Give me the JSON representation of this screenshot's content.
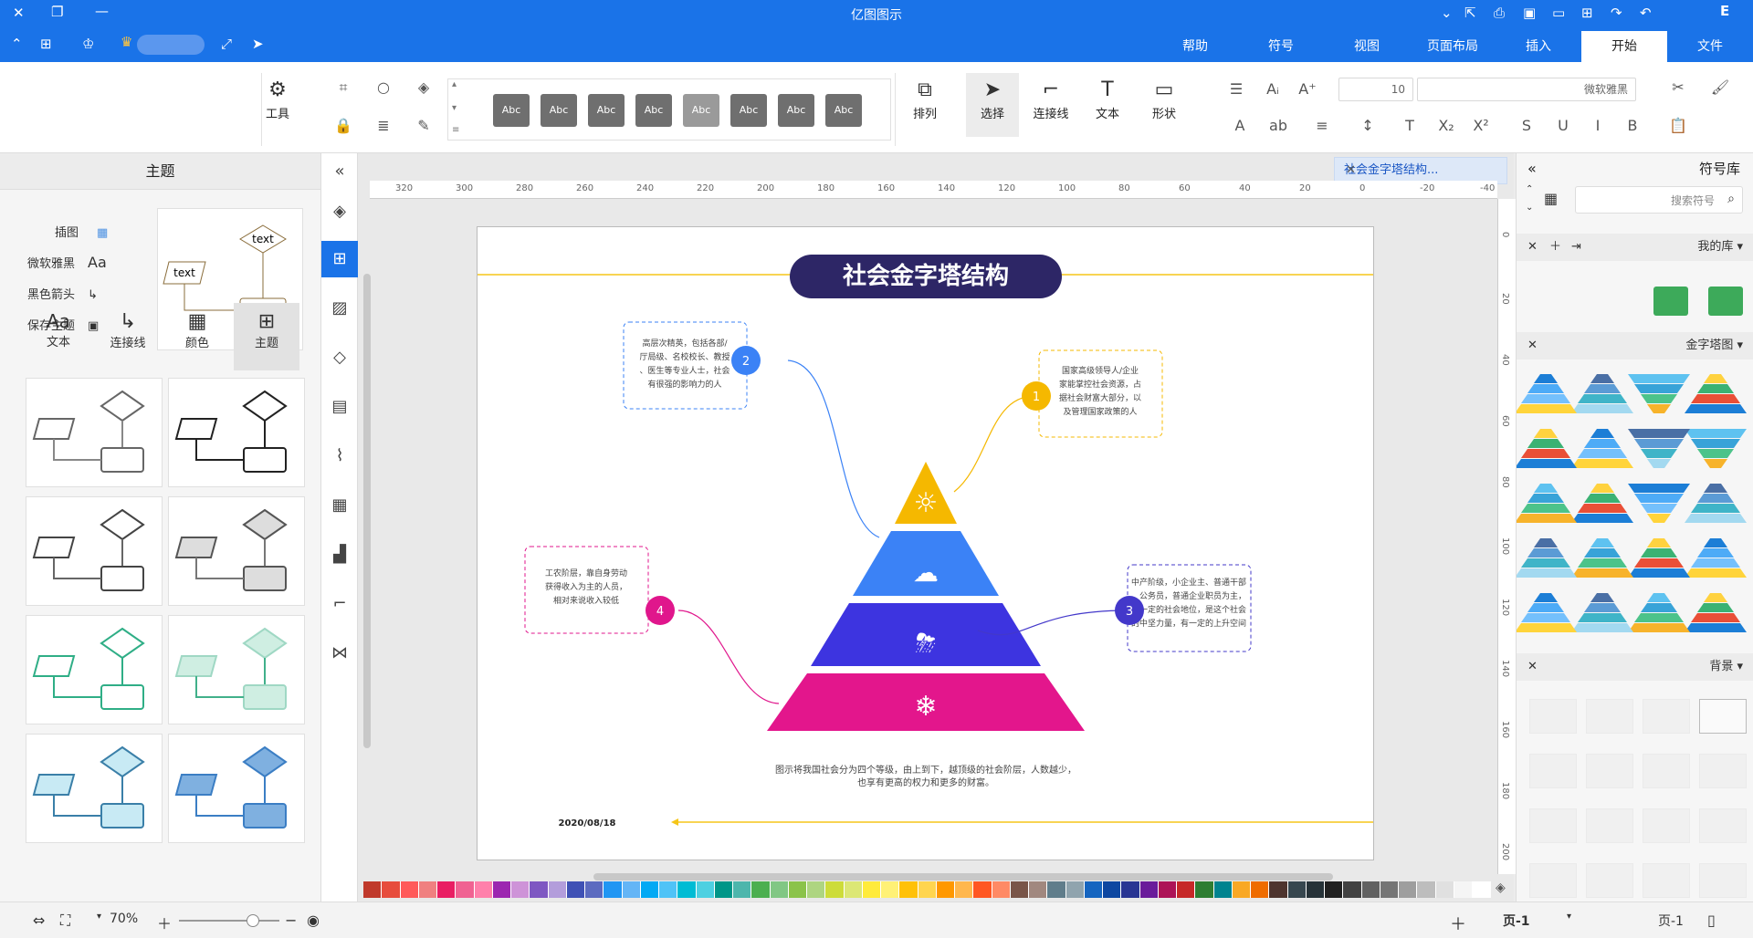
{
  "app": {
    "window_title": "亿图图示",
    "menu_tabs": [
      "文件",
      "开始",
      "插入",
      "页面布局",
      "视图",
      "符号",
      "帮助"
    ],
    "active_tab": "开始"
  },
  "ribbon": {
    "cut_icon": "scissors-icon",
    "paste_icon": "clipboard-icon",
    "format_painter_icon": "brush-icon",
    "font_name": "微软雅黑",
    "font_size": "10",
    "btn_shape": "形状",
    "btn_text": "文本",
    "btn_connector": "连接线",
    "btn_select": "选择",
    "btn_arrange": "排列",
    "btn_tools": "工具",
    "style_chip_label": "Abc"
  },
  "symbols_panel": {
    "title": "符号库",
    "search_placeholder": "搜索符号",
    "my_library": "我的库",
    "pyramid_category": "金字塔图",
    "background_category": "背景"
  },
  "doc_tab": {
    "label": "社会金字塔结构..."
  },
  "ruler": {
    "top_ticks": [
      "-40",
      "-20",
      "0",
      "20",
      "40",
      "60",
      "80",
      "100",
      "120",
      "140",
      "160",
      "180",
      "200",
      "220",
      "240",
      "260",
      "280",
      "300",
      "320"
    ],
    "left_ticks": [
      "0",
      "20",
      "40",
      "60",
      "80",
      "100",
      "120",
      "140",
      "160",
      "180",
      "200"
    ]
  },
  "diagram": {
    "title": "社会金字塔结构",
    "date": "2020/08/18",
    "caption_line1": "图示将我国社会分为四个等级，由上到下，越顶级的社会阶层，人数越少，",
    "caption_line2": "也享有更高的权力和更多的财富。",
    "levels": [
      {
        "num": "1",
        "color": "#f5b800",
        "text": "国家高级领导人/企业家能掌控社会资源，占据社会财富大部分，以及管理国家政策的人"
      },
      {
        "num": "2",
        "color": "#3b82f6",
        "text": "高层次精英，包括各部/厅局级、名校校长、教授、医生等专业人士，社会有很强的影响力的人"
      },
      {
        "num": "3",
        "color": "#4338ca",
        "text": "中产阶级，小企业主、普通干部、公务员，普通企业职员为主，有一定的社会地位，是这个社会的中坚力量，有一定的上升空间"
      },
      {
        "num": "4",
        "color": "#e0168c",
        "text": "工农阶层，靠自身劳动获得收入为主的人员，相对来说收入较低"
      }
    ],
    "pyramid_colors": [
      "#f5b800",
      "#3b82f6",
      "#3d34e0",
      "#e3168c"
    ]
  },
  "theme_panel": {
    "title": "主题",
    "items": [
      "插图",
      "微软雅黑",
      "黑色箭头",
      "保存主题"
    ],
    "tabs": [
      "主题",
      "颜色",
      "连接线",
      "文本"
    ],
    "active_tab": "主题",
    "card_text": "text"
  },
  "status_bar": {
    "page_label": "页-1",
    "page_tab": "页-1",
    "zoom": "70%"
  },
  "palette_colors": [
    "#c0392b",
    "#e74c3c",
    "#ff5a5a",
    "#f08080",
    "#e91e63",
    "#f06292",
    "#ff80ab",
    "#9c27b0",
    "#ce93d8",
    "#7e57c2",
    "#b39ddb",
    "#3f51b5",
    "#5c6bc0",
    "#2196f3",
    "#64b5f6",
    "#03a9f4",
    "#4fc3f7",
    "#00bcd4",
    "#4dd0e1",
    "#009688",
    "#4db6ac",
    "#4caf50",
    "#81c784",
    "#8bc34a",
    "#aed581",
    "#cddc39",
    "#dce775",
    "#ffeb3b",
    "#fff176",
    "#ffc107",
    "#ffd54f",
    "#ff9800",
    "#ffb74d",
    "#ff5722",
    "#ff8a65",
    "#795548",
    "#a1887f",
    "#607d8b",
    "#90a4ae",
    "#1565c0",
    "#0d47a1",
    "#283593",
    "#6a1b9a",
    "#ad1457",
    "#c62828",
    "#2e7d32",
    "#00838f",
    "#f9a825",
    "#ef6c00",
    "#4e342e",
    "#37474f",
    "#263238",
    "#212121",
    "#424242",
    "#616161",
    "#757575",
    "#9e9e9e",
    "#bdbdbd",
    "#e0e0e0",
    "#f5f5f5",
    "#ffffff"
  ]
}
